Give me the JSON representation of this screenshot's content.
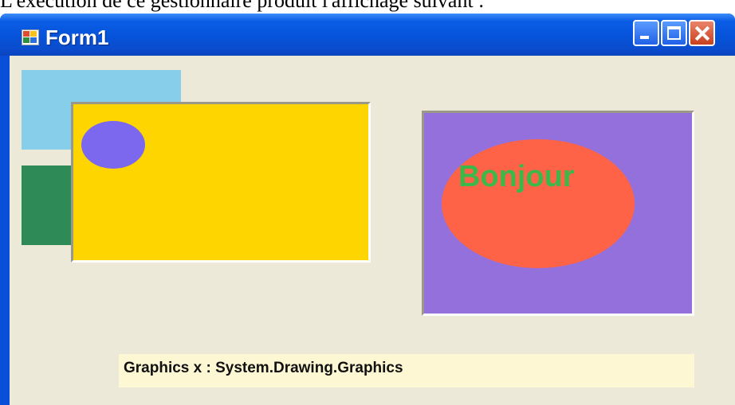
{
  "document": {
    "text": "L'exécution de ce gestionnaire produit l'affichage suivant :"
  },
  "window": {
    "title": "Form1",
    "caption_buttons": {
      "minimize": "minimize",
      "maximize": "maximize",
      "close": "close"
    }
  },
  "canvas": {
    "colors": {
      "form_background": "#ece9d8",
      "light_blue_rect": "#87ceeb",
      "green_rect": "#2e8b57",
      "yellow_panel": "#ffd500",
      "small_ellipse": "#7b68ee",
      "purple_panel": "#9370db",
      "tomato_ellipse": "#ff6347",
      "text_green": "#3cb84b"
    },
    "purple_panel_text": "Bonjour"
  },
  "label": {
    "text": "Graphics x : System.Drawing.Graphics"
  }
}
